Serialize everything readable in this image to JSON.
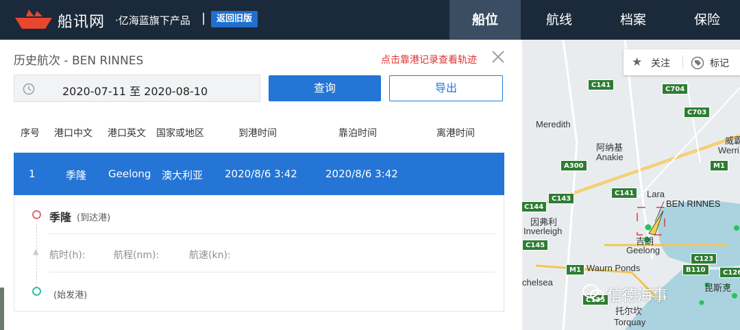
{
  "nav": {
    "brand": "船讯网",
    "brand_sub": "·亿海蓝旗下产品",
    "brand_sep": "|",
    "old_version_label": "返回旧版",
    "tabs": [
      {
        "label": "船位",
        "active": true
      },
      {
        "label": "航线",
        "active": false
      },
      {
        "label": "档案",
        "active": false
      },
      {
        "label": "保险",
        "active": false
      }
    ]
  },
  "panel": {
    "title": "历史航次 - BEN RINNES",
    "track_link": "点击靠港记录查看轨迹",
    "date_range": "2020-07-11 至 2020-08-10",
    "query_label": "查询",
    "export_label": "导出",
    "columns": [
      "序号",
      "港口中文",
      "港口英文",
      "国家或地区",
      "到港时间",
      "靠泊时间",
      "离港时间"
    ],
    "rows": [
      {
        "index": "1",
        "port_cn": "季隆",
        "port_en": "Geelong",
        "country": "澳大利亚",
        "arrival": "2020/8/6 3:42",
        "berth": "2020/8/6 3:42",
        "departure": ""
      }
    ],
    "detail": {
      "arrival_port": "季隆",
      "arrival_tag": "(到达港)",
      "duration_label": "航时(h):",
      "distance_label": "航程(nm):",
      "speed_label": "航速(kn):",
      "origin_tag": "(始发港)"
    }
  },
  "map": {
    "toolbar": {
      "follow_label": "关注",
      "mark_label": "标记"
    },
    "ship_label": "BEN RINNES",
    "places": [
      {
        "text": "Meredith"
      },
      {
        "text": "阿纳基"
      },
      {
        "text": "Anakie"
      },
      {
        "text": "威霸"
      },
      {
        "text": "Werri"
      },
      {
        "text": "Lara"
      },
      {
        "text": "因弗利"
      },
      {
        "text": "Inverleigh"
      },
      {
        "text": "吉朗"
      },
      {
        "text": "Geelong"
      },
      {
        "text": "Waurn Ponds"
      },
      {
        "text": "chelsea"
      },
      {
        "text": "托尔坎"
      },
      {
        "text": "Torquay"
      },
      {
        "text": "昆斯克"
      }
    ],
    "roads": [
      "C141",
      "C704",
      "C703",
      "A300",
      "M1",
      "C141",
      "C143",
      "C144",
      "C145",
      "C123",
      "M1",
      "B110",
      "C126",
      "C135"
    ],
    "watermark": "信德海事",
    "colors": {
      "water": "#aad3df",
      "land": "#e9ecef",
      "road_shield": "#2e7d32",
      "ship_box": "#e53935",
      "ship_dot": "#22c55e"
    }
  },
  "colors": {
    "nav_bg": "#1b2a3a",
    "nav_active": "#3a4d62",
    "accent": "#2475d6",
    "link_red": "#e03030"
  }
}
